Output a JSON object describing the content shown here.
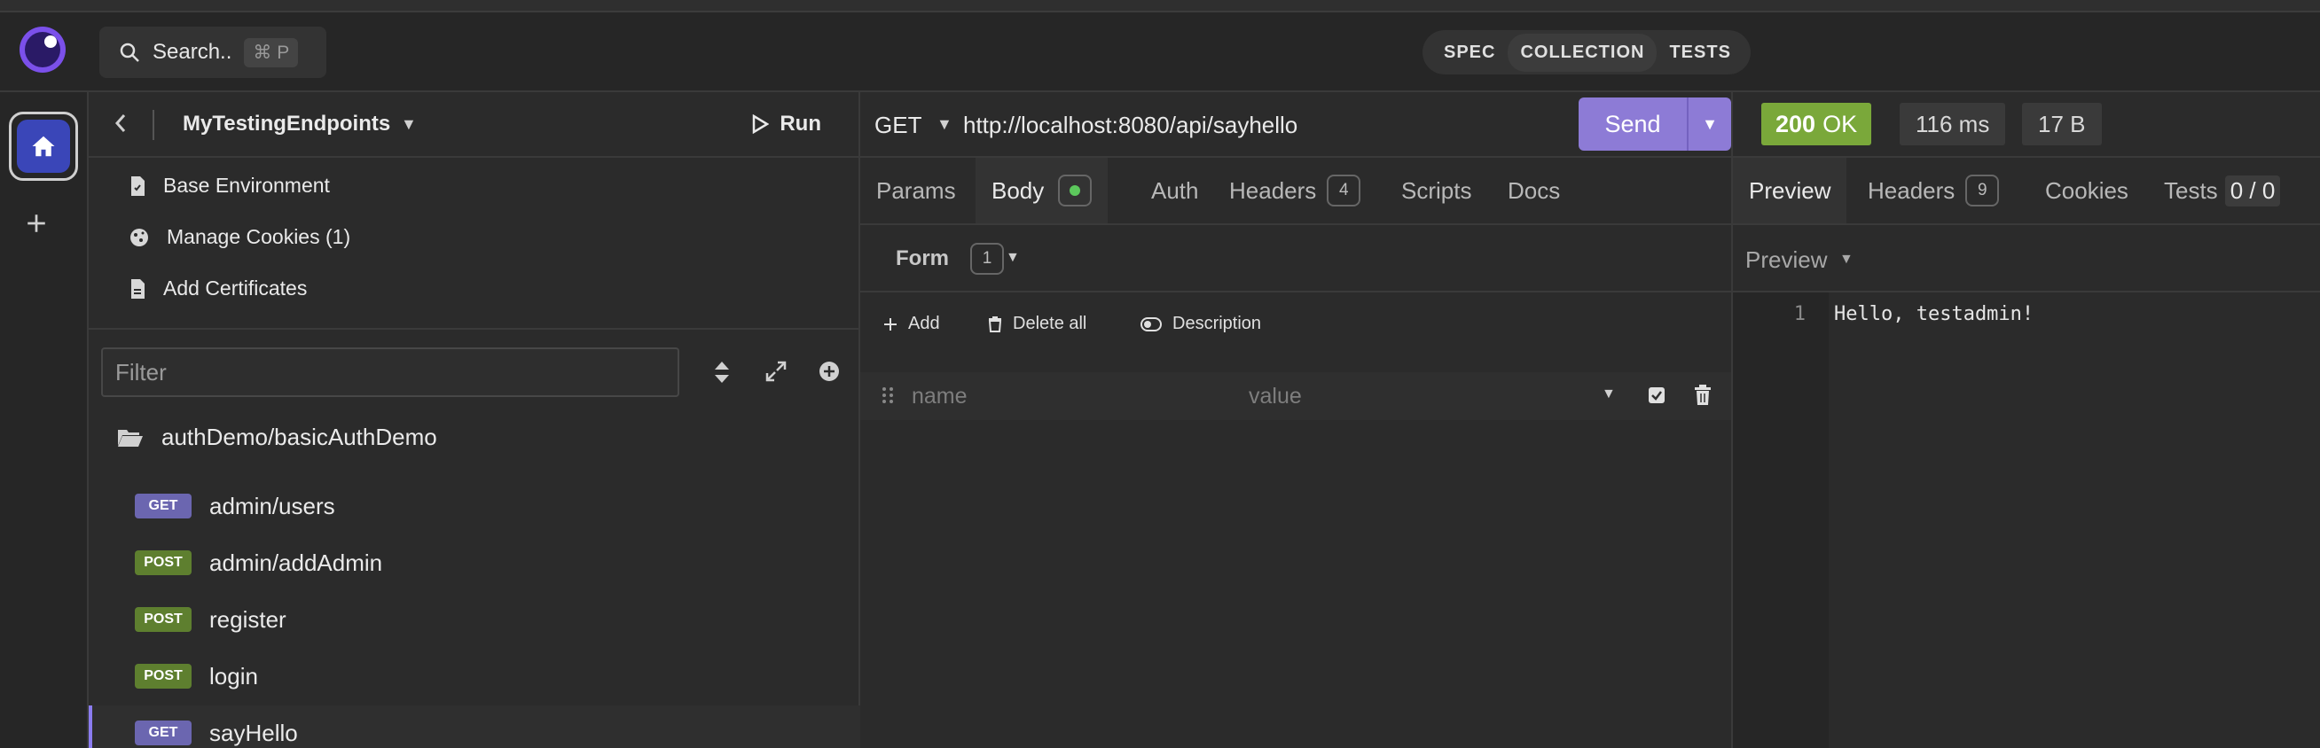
{
  "topbar": {
    "search_label": "Search..",
    "search_shortcut": "⌘ P",
    "modes": [
      "SPEC",
      "COLLECTION",
      "TESTS"
    ],
    "active_mode": "COLLECTION"
  },
  "rail": {
    "home_icon": "home-icon",
    "add_icon": "plus-icon"
  },
  "sidebar": {
    "project_name": "MyTestingEndpoints",
    "run_label": "Run",
    "menu": [
      {
        "label": "Base Environment",
        "icon": "environment-doc-icon"
      },
      {
        "label": "Manage Cookies (1)",
        "icon": "cookie-icon"
      },
      {
        "label": "Add Certificates",
        "icon": "certificate-doc-icon"
      }
    ],
    "filter_placeholder": "Filter",
    "folder": "authDemo/basicAuthDemo",
    "requests": [
      {
        "method": "GET",
        "name": "admin/users"
      },
      {
        "method": "POST",
        "name": "admin/addAdmin"
      },
      {
        "method": "POST",
        "name": "register"
      },
      {
        "method": "POST",
        "name": "login"
      },
      {
        "method": "GET",
        "name": "sayHello",
        "active": true
      }
    ]
  },
  "request": {
    "method": "GET",
    "url": "http://localhost:8080/api/sayhello",
    "send_label": "Send",
    "tabs": {
      "params": "Params",
      "body": "Body",
      "auth": "Auth",
      "headers": "Headers",
      "headers_count": "4",
      "scripts": "Scripts",
      "docs": "Docs"
    },
    "body_mode": "Form",
    "body_count": "1",
    "actions": {
      "add": "Add",
      "delete_all": "Delete all",
      "description": "Description"
    },
    "param_name_placeholder": "name",
    "param_value_placeholder": "value"
  },
  "response": {
    "status_code": "200",
    "status_text": "OK",
    "time": "116 ms",
    "size": "17 B",
    "tabs": {
      "preview": "Preview",
      "headers": "Headers",
      "headers_count": "9",
      "cookies": "Cookies",
      "tests": "Tests",
      "tests_count": "0 / 0"
    },
    "preview_mode": "Preview",
    "line_number": "1",
    "body_text": "Hello, testadmin!"
  },
  "colors": {
    "accent": "#8d7bd6",
    "status_ok": "#7aa83a",
    "get_badge": "#6b66b0",
    "post_badge": "#5e7f2f"
  }
}
